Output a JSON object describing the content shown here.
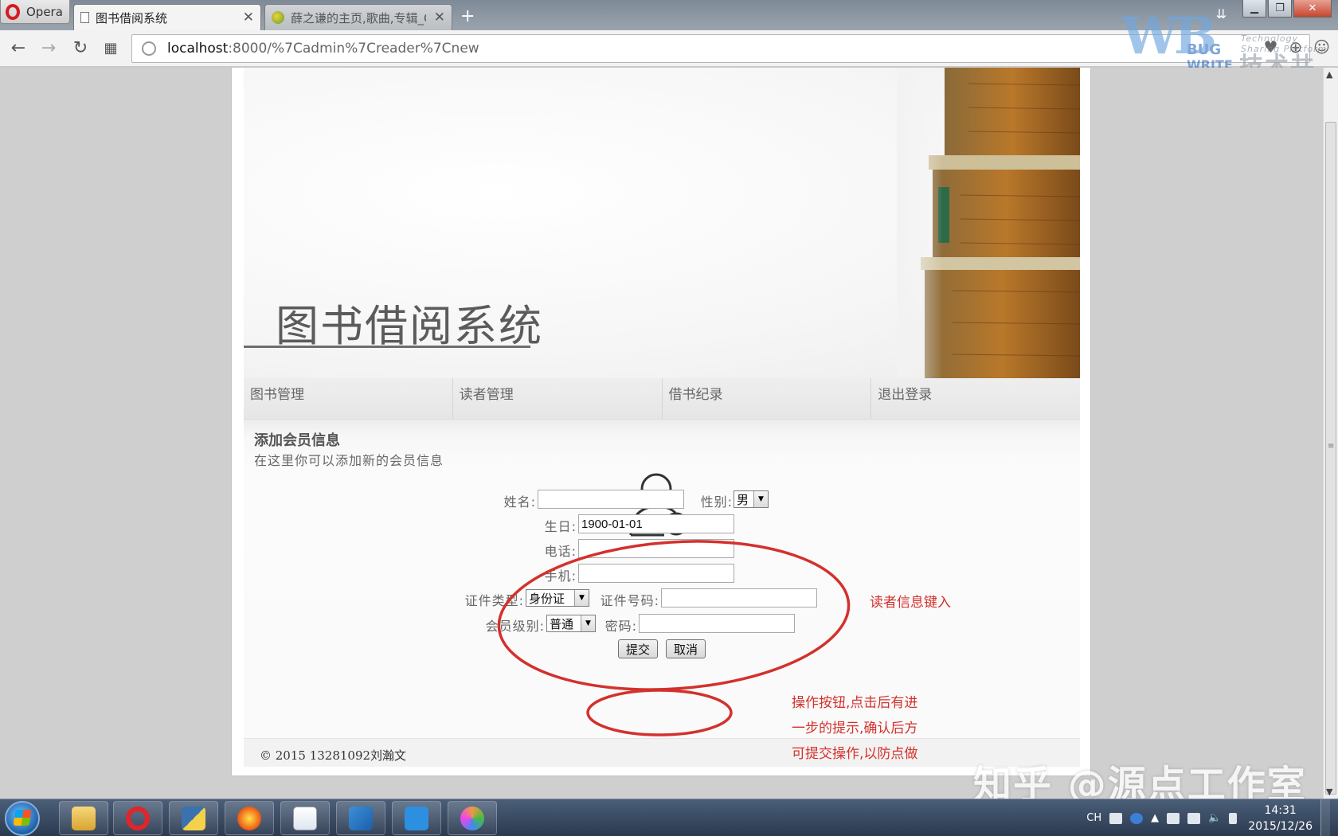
{
  "browser": {
    "menu_label": "Opera",
    "tabs": [
      {
        "title": "图书借阅系统",
        "active": true
      },
      {
        "title": "薛之谦的主页,歌曲,专辑_Q",
        "active": false
      }
    ],
    "url_host": "localhost",
    "url_path": ":8000/%7Cadmin%7Creader%7Cnew"
  },
  "watermark_top": {
    "big": "WB",
    "bug": "BUG",
    "write": "WRITE",
    "tagline": "Technology Sharing Platform",
    "cn": "技术共享平台"
  },
  "site": {
    "banner_title": "图书借阅系统",
    "nav": [
      "图书管理",
      "读者管理",
      "借书纪录",
      "退出登录"
    ]
  },
  "section": {
    "title": "添加会员信息",
    "subtitle": "在这里你可以添加新的会员信息"
  },
  "form": {
    "name_label": "姓名:",
    "name_value": "",
    "gender_label": "性别:",
    "gender_value": "男",
    "birthday_label": "生日:",
    "birthday_value": "1900-01-01",
    "phone_label": "电话:",
    "phone_value": "",
    "mobile_label": "手机:",
    "mobile_value": "",
    "id_type_label": "证件类型:",
    "id_type_value": "身份证",
    "id_number_label": "证件号码:",
    "id_number_value": "",
    "level_label": "会员级别:",
    "level_value": "普通",
    "password_label": "密码:",
    "password_value": "",
    "submit_label": "提交",
    "cancel_label": "取消"
  },
  "footer": {
    "text": "© 2015  13281092刘瀚文"
  },
  "annotations": {
    "input_note": "读者信息键入",
    "button_note": [
      "操作按钮,点击后有进",
      "一步的提示,确认后方",
      "可提交操作,以防点做"
    ],
    "color": "#d3312c"
  },
  "watermark_bottom": "知乎 @源点工作室",
  "taskbar": {
    "lang": "CH",
    "time": "14:31",
    "date": "2015/12/26"
  }
}
